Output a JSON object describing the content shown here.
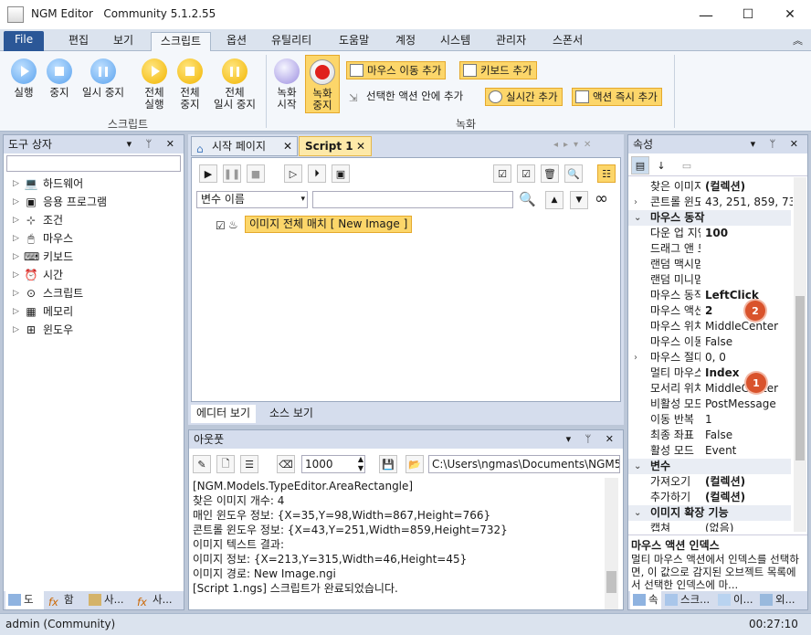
{
  "window": {
    "app_name": "NGM Editor",
    "edition": "Community 5.1.2.55",
    "minimize": "—",
    "maximize": "☐",
    "close": "✕"
  },
  "menu": {
    "file": "File",
    "items": [
      "편집",
      "보기",
      "스크립트",
      "옵션",
      "유틸리티",
      "도움말",
      "계정",
      "시스템",
      "관리자",
      "스폰서"
    ],
    "active_index": 2,
    "collapse": "︽"
  },
  "ribbon": {
    "script_group": {
      "label": "스크립트",
      "buttons": [
        "실행",
        "중지",
        "일시 중지"
      ],
      "all_buttons": [
        [
          "전체",
          "실행"
        ],
        [
          "전체",
          "중지"
        ],
        [
          "전체",
          "일시 중지"
        ]
      ]
    },
    "record_group": {
      "label": "녹화",
      "record_start": [
        "녹화",
        "시작"
      ],
      "record_stop": [
        "녹화",
        "중지"
      ],
      "mouse_move_add": "마우스 이동 추가",
      "keyboard_add": "키보드 추가",
      "in_selected_action_add": "선택한 액션 안에 추가",
      "realtime_add": "실시간 추가",
      "instant_action_add": "액션 즉시 추가"
    }
  },
  "toolbox": {
    "title": "도구 상자",
    "search_placeholder": "",
    "items": [
      {
        "label": "하드웨어",
        "icon": "laptop-icon"
      },
      {
        "label": "응용 프로그램",
        "icon": "terminal-icon"
      },
      {
        "label": "조건",
        "icon": "hierarchy-icon"
      },
      {
        "label": "마우스",
        "icon": "mouse-icon"
      },
      {
        "label": "키보드",
        "icon": "keyboard-icon"
      },
      {
        "label": "시간",
        "icon": "alarm-clock-icon"
      },
      {
        "label": "스크립트",
        "icon": "code-icon"
      },
      {
        "label": "메모리",
        "icon": "memory-icon"
      },
      {
        "label": "윈도우",
        "icon": "windows-icon"
      }
    ],
    "bottom_tabs": [
      "도",
      "함",
      "사...",
      "사..."
    ]
  },
  "editor": {
    "tabs": [
      "시작 페이지",
      "Script 1"
    ],
    "var_select": "변수 이름",
    "var_search": "",
    "node_label": "이미지 전체 매치 [ New Image ]",
    "bottom_tabs": [
      "에디터 보기",
      "소스 보기"
    ]
  },
  "output": {
    "title": "아웃풋",
    "count": "1000",
    "path": "C:\\Users\\ngmas\\Documents\\NGM5\\",
    "lines": [
      "[NGM.Models.TypeEditor.AreaRectangle]",
      "찾은 이미지 개수: 4",
      "매인 윈도우 정보: {X=35,Y=98,Width=867,Height=766}",
      "콘트롤 윈도우 정보: {X=43,Y=251,Width=859,Height=732}",
      "이미지 텍스트 결과:",
      "이미지 정보: {X=213,Y=315,Width=46,Height=45}",
      "이미지 경로: New Image.ngi",
      "[Script 1.ngs] 스크립트가 완료되었습니다."
    ]
  },
  "properties": {
    "title": "속성",
    "rows": [
      {
        "key": "찾은 이미지",
        "value": "(컬렉션)",
        "bold": true
      },
      {
        "key": "콘트롤 윈도우",
        "value": "43, 251, 859, 732",
        "expand": true
      },
      {
        "cat": "마우스 동작"
      },
      {
        "key": "다운 업 지연",
        "value": "100",
        "bold": true
      },
      {
        "key": "드래그 앤 드롭",
        "value": ""
      },
      {
        "key": "랜덤 맥시멈",
        "value": ""
      },
      {
        "key": "랜덤 미니멈",
        "value": ""
      },
      {
        "key": "마우스 동작",
        "value": "LeftClick",
        "bold": true
      },
      {
        "key": "마우스 액션",
        "value": "2",
        "bold": true
      },
      {
        "key": "마우스 위치",
        "value": "MiddleCenter"
      },
      {
        "key": "마우스 이동",
        "value": "False"
      },
      {
        "key": "마우스 절대",
        "value": "0, 0",
        "expand": true
      },
      {
        "key": "멀티 마우스",
        "value": "Index",
        "bold": true
      },
      {
        "key": "모서리 위치",
        "value": "MiddleCenter"
      },
      {
        "key": "비활성 모드",
        "value": "PostMessage"
      },
      {
        "key": "이동 반복",
        "value": "1"
      },
      {
        "key": "최종 좌표",
        "value": "False"
      },
      {
        "key": "활성 모드",
        "value": "Event"
      },
      {
        "cat": "변수"
      },
      {
        "key": "가져오기",
        "value": "(컬렉션)",
        "bold": true
      },
      {
        "key": "추가하기",
        "value": "(컬렉션)",
        "bold": true
      },
      {
        "cat": "이미지 확장 기능"
      },
      {
        "key": "캡쳐",
        "value": "(없음)"
      }
    ],
    "desc_title": "마우스 액션 인덱스",
    "desc_text": "멀티 마우스 액션에서 인덱스를 선택하면, 이 값으로 감지된 오브젝트 목록에서 선택한 인덱스에 마...",
    "badge1": "1",
    "badge2": "2",
    "bottom_tabs": [
      "속",
      "스크...",
      "이...",
      "외..."
    ]
  },
  "status": {
    "user": "admin (Community)",
    "time": "00:27:10"
  }
}
